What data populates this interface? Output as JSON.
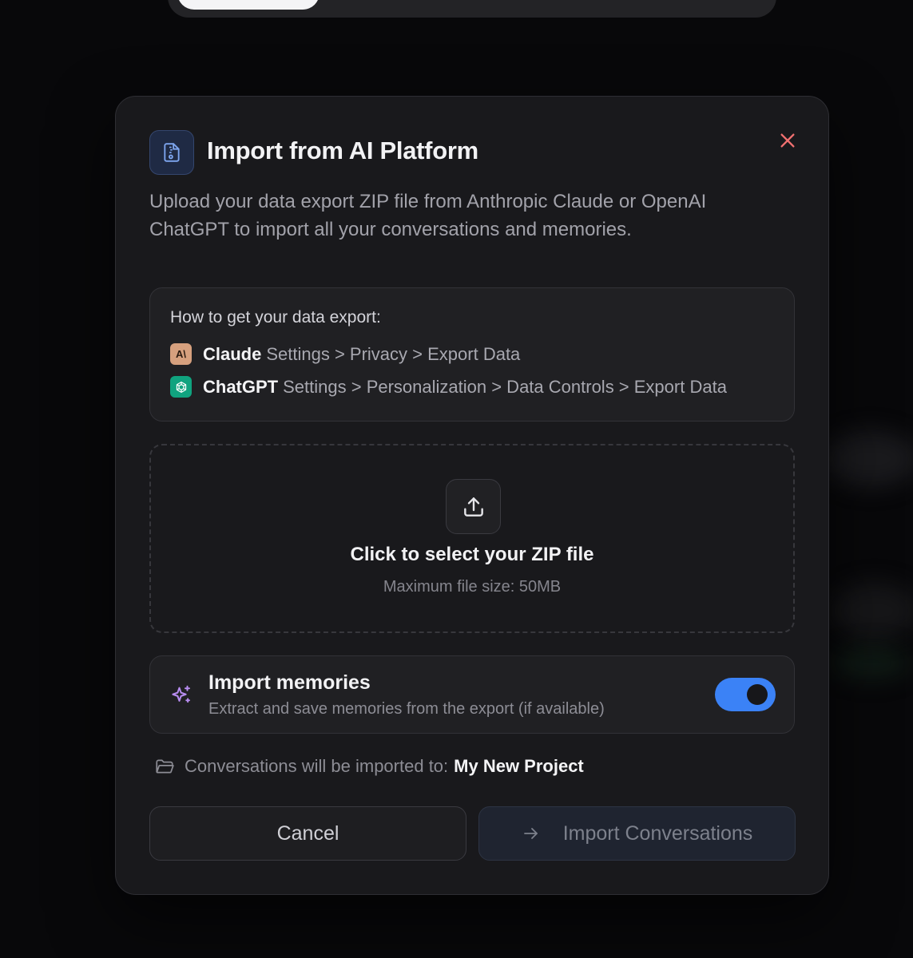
{
  "dialog": {
    "title": "Import from AI Platform",
    "description": "Upload your data export ZIP file from Anthropic Claude or OpenAI ChatGPT to import all your conversations and memories.",
    "close_icon": "close-icon",
    "header_icon": "file-zip-icon"
  },
  "instructions": {
    "title": "How to get your data export:",
    "providers": [
      {
        "name": "Claude",
        "path": "Settings > Privacy > Export Data",
        "badge_text": "A\\",
        "icon": "anthropic-logo",
        "color": "#d6a07e"
      },
      {
        "name": "ChatGPT",
        "path": "Settings > Personalization > Data Controls > Export Data",
        "icon": "openai-logo",
        "color": "#10a37f"
      }
    ]
  },
  "dropzone": {
    "icon": "upload-icon",
    "title": "Click to select your ZIP file",
    "subtitle": "Maximum file size: 50MB"
  },
  "memories": {
    "icon": "sparkle-icon",
    "title": "Import memories",
    "subtitle": "Extract and save memories from the export (if available)",
    "enabled": true
  },
  "destination": {
    "icon": "folder-icon",
    "label": "Conversations will be imported to:",
    "project": "My New Project"
  },
  "actions": {
    "cancel_label": "Cancel",
    "import_label": "Import Conversations",
    "import_icon": "arrow-right-icon"
  },
  "colors": {
    "accent": "#3b82f6",
    "close": "#f07070",
    "sparkle": "#b78cf0"
  }
}
